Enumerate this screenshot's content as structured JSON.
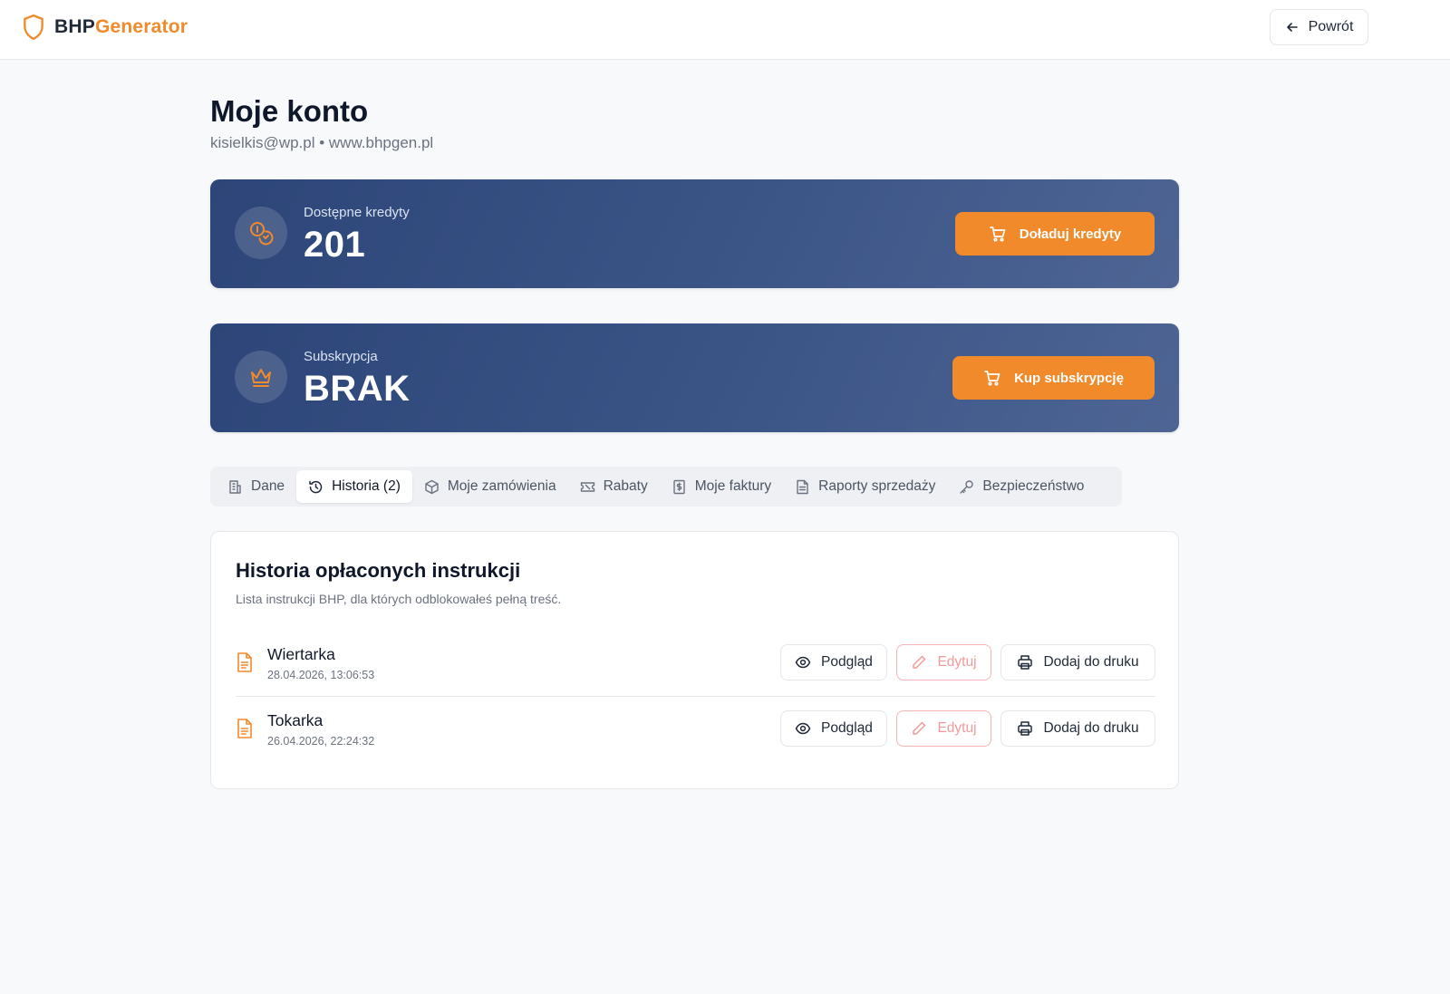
{
  "header": {
    "logo_part1": "BHP",
    "logo_part2": "Generator",
    "back_label": "Powrót"
  },
  "page": {
    "title": "Moje konto",
    "subtitle": "kisielkis@wp.pl • www.bhpgen.pl"
  },
  "credits": {
    "label": "Dostępne kredyty",
    "value": "201",
    "button_label": "Doładuj kredyty"
  },
  "subscription": {
    "label": "Subskrypcja",
    "value": "BRAK",
    "button_label": "Kup subskrypcję"
  },
  "tabs": [
    {
      "label": "Dane",
      "icon": "building-icon",
      "active": false
    },
    {
      "label": "Historia (2)",
      "icon": "history-icon",
      "active": true
    },
    {
      "label": "Moje zamówienia",
      "icon": "package-icon",
      "active": false
    },
    {
      "label": "Rabaty",
      "icon": "ticket-icon",
      "active": false
    },
    {
      "label": "Moje faktury",
      "icon": "invoice-icon",
      "active": false
    },
    {
      "label": "Raporty sprzedaży",
      "icon": "report-icon",
      "active": false
    },
    {
      "label": "Bezpieczeństwo",
      "icon": "key-icon",
      "active": false
    }
  ],
  "history": {
    "title": "Historia opłaconych instrukcji",
    "description": "Lista instrukcji BHP, dla których odblokowałeś pełną treść.",
    "preview_label": "Podgląd",
    "edit_label": "Edytuj",
    "print_label": "Dodaj do druku",
    "items": [
      {
        "name": "Wiertarka",
        "date": "28.04.2026, 13:06:53"
      },
      {
        "name": "Tokarka",
        "date": "26.04.2026, 22:24:32"
      }
    ]
  },
  "colors": {
    "accent": "#f08a2b",
    "card_dark": "#2d4578",
    "edit_disabled": "#f19a9a"
  }
}
